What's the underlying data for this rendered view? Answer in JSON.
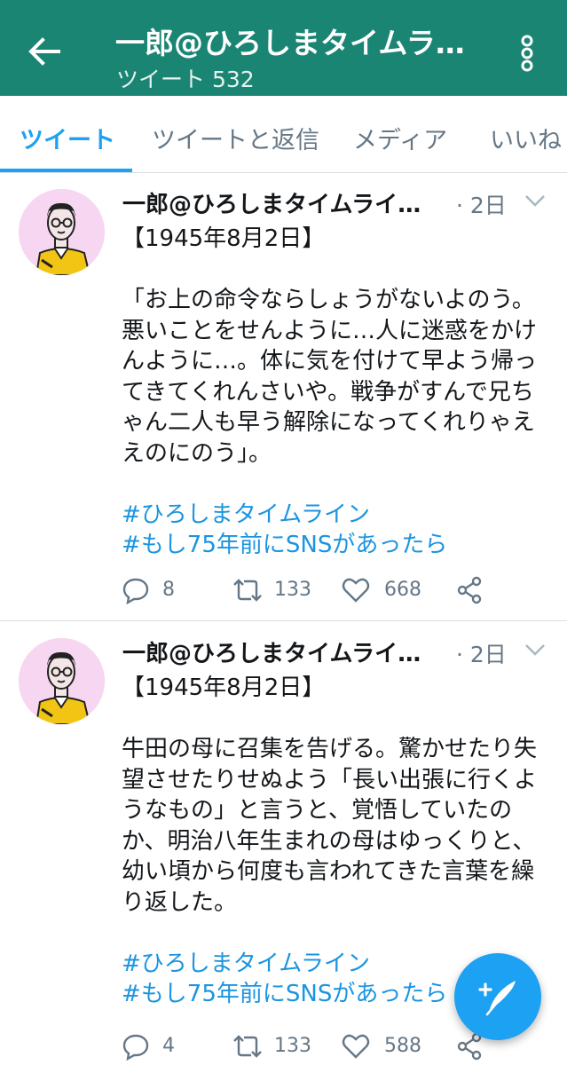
{
  "header": {
    "title": "一郎@ひろしまタイムラ…",
    "subtitle": "ツイート 532",
    "back_icon": "arrow-left-icon",
    "overflow_icon": "more-vertical-icon"
  },
  "tabs": [
    {
      "label": "ツイート",
      "active": true
    },
    {
      "label": "ツイートと返信",
      "active": false
    },
    {
      "label": "メディア",
      "active": false
    },
    {
      "label": "いいね",
      "active": false
    }
  ],
  "tweets": [
    {
      "author": "一郎@ひろしまタイムライン …",
      "time": "· 2日",
      "date_line": "【1945年8月2日】",
      "text": "「お上の命令ならしょうがないよのう。悪いことをせんように…人に迷惑をかけんように…。体に気を付けて早よう帰ってきてくれんさいや。戦争がすんで兄ちゃん二人も早う解除になってくれりゃええのにのう」。",
      "hashtags": [
        "#ひろしまタイムライン",
        "#もし75年前にSNSがあったら"
      ],
      "replies": "8",
      "retweets": "133",
      "likes": "668"
    },
    {
      "author": "一郎@ひろしまタイムライン …",
      "time": "· 2日",
      "date_line": "【1945年8月2日】",
      "text": "牛田の母に召集を告げる。驚かせたり失望させたりせぬよう「長い出張に行くようなもの」と言うと、覚悟していたのか、明治八年生まれの母はゆっくりと、幼い頃から何度も言われてきた言葉を繰り返した。",
      "hashtags": [
        "#ひろしまタイムライン",
        "#もし75年前にSNSがあったら"
      ],
      "replies": "4",
      "retweets": "133",
      "likes": "588"
    }
  ],
  "fab": {
    "icon": "compose-tweet-icon"
  },
  "colors": {
    "header_bg": "#1b8574",
    "accent": "#1da1f2",
    "hashtag": "#1b95e0",
    "muted": "#657786",
    "avatar_bg": "#f7d6f1"
  }
}
